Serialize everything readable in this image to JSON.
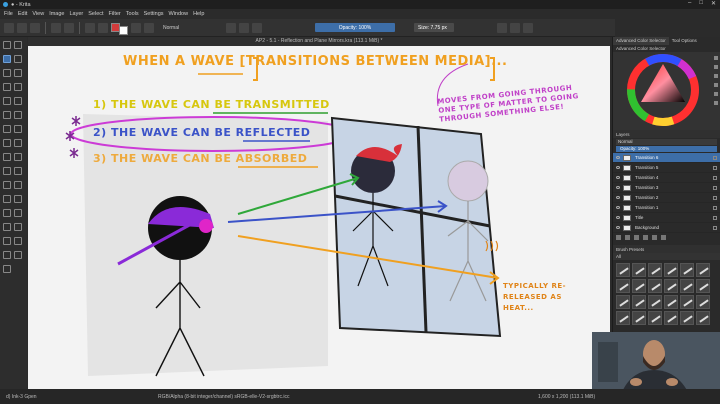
{
  "window": {
    "title": "● - Krita",
    "controls": [
      "–",
      "□",
      "✕"
    ]
  },
  "menu": [
    "File",
    "Edit",
    "View",
    "Image",
    "Layer",
    "Select",
    "Filter",
    "Tools",
    "Settings",
    "Window",
    "Help"
  ],
  "toolbar": {
    "blend_mode": "Normal",
    "opacity_label": "Opacity: 100%",
    "size_label": "Size: 7.75 px"
  },
  "document_tab": "AP2 - 5.1 - Reflection and Plane Mirrors.kra (113.1 MiB) *",
  "canvas": {
    "title": "WHEN A WAVE [TRANSITIONS BETWEEN MEDIA]...",
    "item1": "1) THE WAVE CAN BE TRANSMITTED",
    "item2": "2) THE WAVE CAN BE REFLECTED",
    "item3": "3) THE WAVE CAN BE ABSORBED",
    "note": "MOVES FROM GOING THROUGH ONE TYPE OF MATTER TO GOING THROUGH SOMETHING ELSE!",
    "heat_note": "TYPICALLY RE-RELEASED AS HEAT..."
  },
  "dock": {
    "tabs": [
      "Advanced Color Selector",
      "Tool Options"
    ],
    "color_panel_title": "Advanced Color Selector",
    "layers_title": "Layers",
    "layer_mode": "Normal",
    "layer_opacity": "Opacity: 100%",
    "layers": [
      {
        "name": "Transition 6",
        "active": true
      },
      {
        "name": "Transition 5",
        "active": false
      },
      {
        "name": "Transition 4",
        "active": false
      },
      {
        "name": "Transition 3",
        "active": false
      },
      {
        "name": "Transition 2",
        "active": false
      },
      {
        "name": "Transition 1",
        "active": false
      },
      {
        "name": "Title",
        "active": false
      },
      {
        "name": "Background",
        "active": false
      }
    ],
    "brush_title": "Brush Presets",
    "brush_filter": "All"
  },
  "status": {
    "brush": "d) Ink-3 Gpen",
    "color_space": "RGB/Alpha (8-bit integer/channel)  sRGB-elle-V2-srgbtrc.icc",
    "doc_size": "1,600 x 1,200 (113.1 MiB)"
  },
  "colors": {
    "accent": "#3d6ea8",
    "title_orange": "#f0a020",
    "item1_yellow": "#d7c70e",
    "item2_blue": "#3b53c8",
    "note_magenta": "#c040c8",
    "ellipse_magenta": "#cc3bd6"
  }
}
